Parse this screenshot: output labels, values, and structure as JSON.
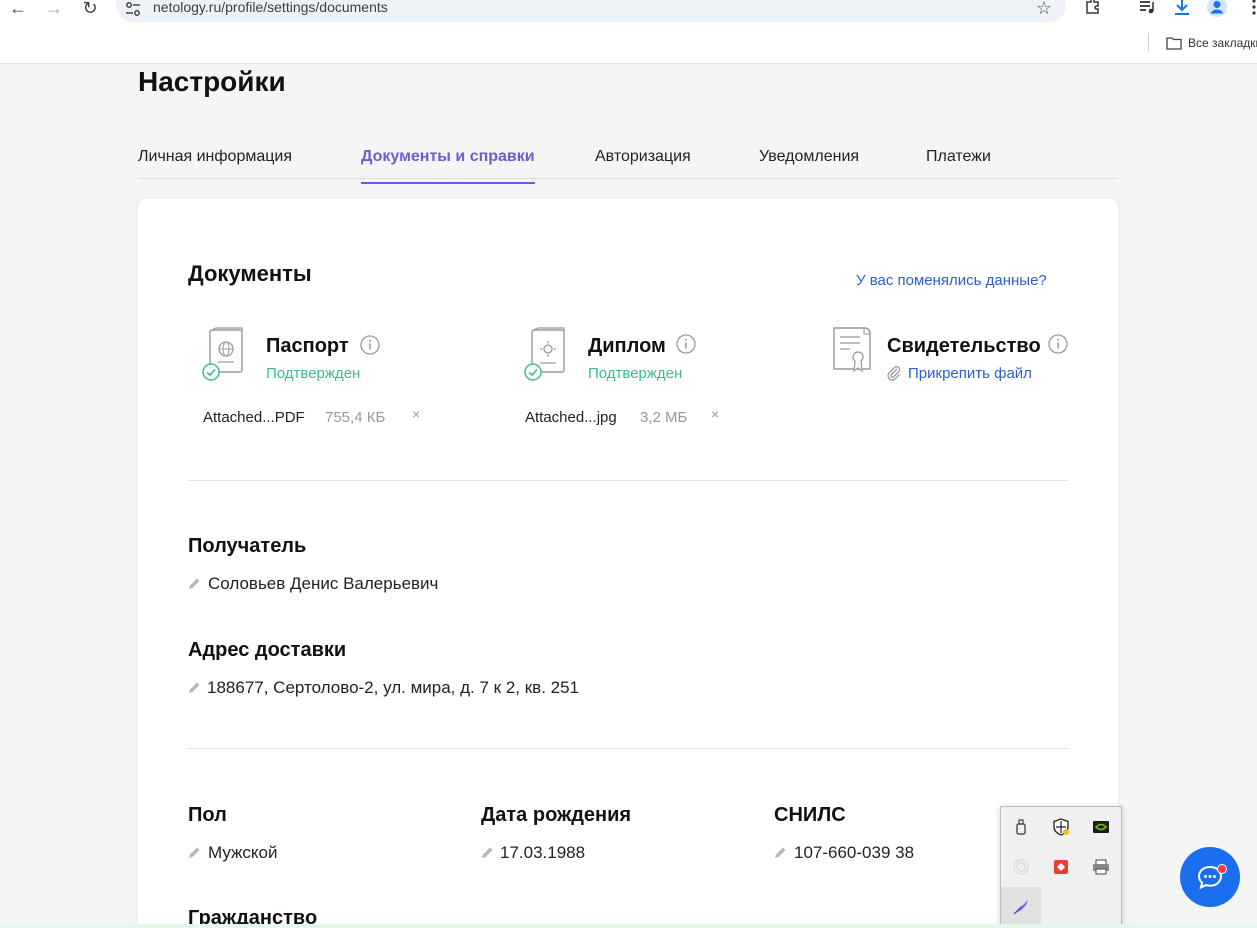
{
  "browser": {
    "url": "netology.ru/profile/settings/documents",
    "bookmarks_label": "Все закладки"
  },
  "page": {
    "title": "Настройки",
    "tabs": [
      {
        "label": "Личная информация",
        "active": false
      },
      {
        "label": "Документы и справки",
        "active": true
      },
      {
        "label": "Авторизация",
        "active": false
      },
      {
        "label": "Уведомления",
        "active": false
      },
      {
        "label": "Платежи",
        "active": false
      }
    ]
  },
  "documents": {
    "heading": "Документы",
    "changed_link": "У вас поменялись данные?",
    "items": [
      {
        "name": "Паспорт",
        "status": "Подтвержден",
        "file_name": "Attached...PDF",
        "file_size": "755,4 КБ",
        "icon": "passport-icon"
      },
      {
        "name": "Диплом",
        "status": "Подтвержден",
        "file_name": "Attached...jpg",
        "file_size": "3,2 МБ",
        "icon": "diploma-icon"
      },
      {
        "name": "Свидетельство",
        "attach_label": "Прикрепить файл",
        "icon": "certificate-icon"
      }
    ],
    "remove_glyph": "×"
  },
  "recipient": {
    "label": "Получатель",
    "value": "Соловьев Денис Валерьевич"
  },
  "address": {
    "label": "Адрес доставки",
    "value": "188677, Сертолово-2, ул. мира, д. 7 к 2, кв. 251"
  },
  "personal": {
    "gender_label": "Пол",
    "gender_value": "Мужской",
    "birth_label": "Дата рождения",
    "birth_value": "17.03.1988",
    "snils_label": "СНИЛС",
    "snils_value": "107-660-039 38",
    "citizenship_label": "Гражданство"
  },
  "colors": {
    "accent": "#6b5cd6",
    "link": "#2c5fd1",
    "success": "#3bbd8a",
    "chat": "#1a6ff0"
  }
}
